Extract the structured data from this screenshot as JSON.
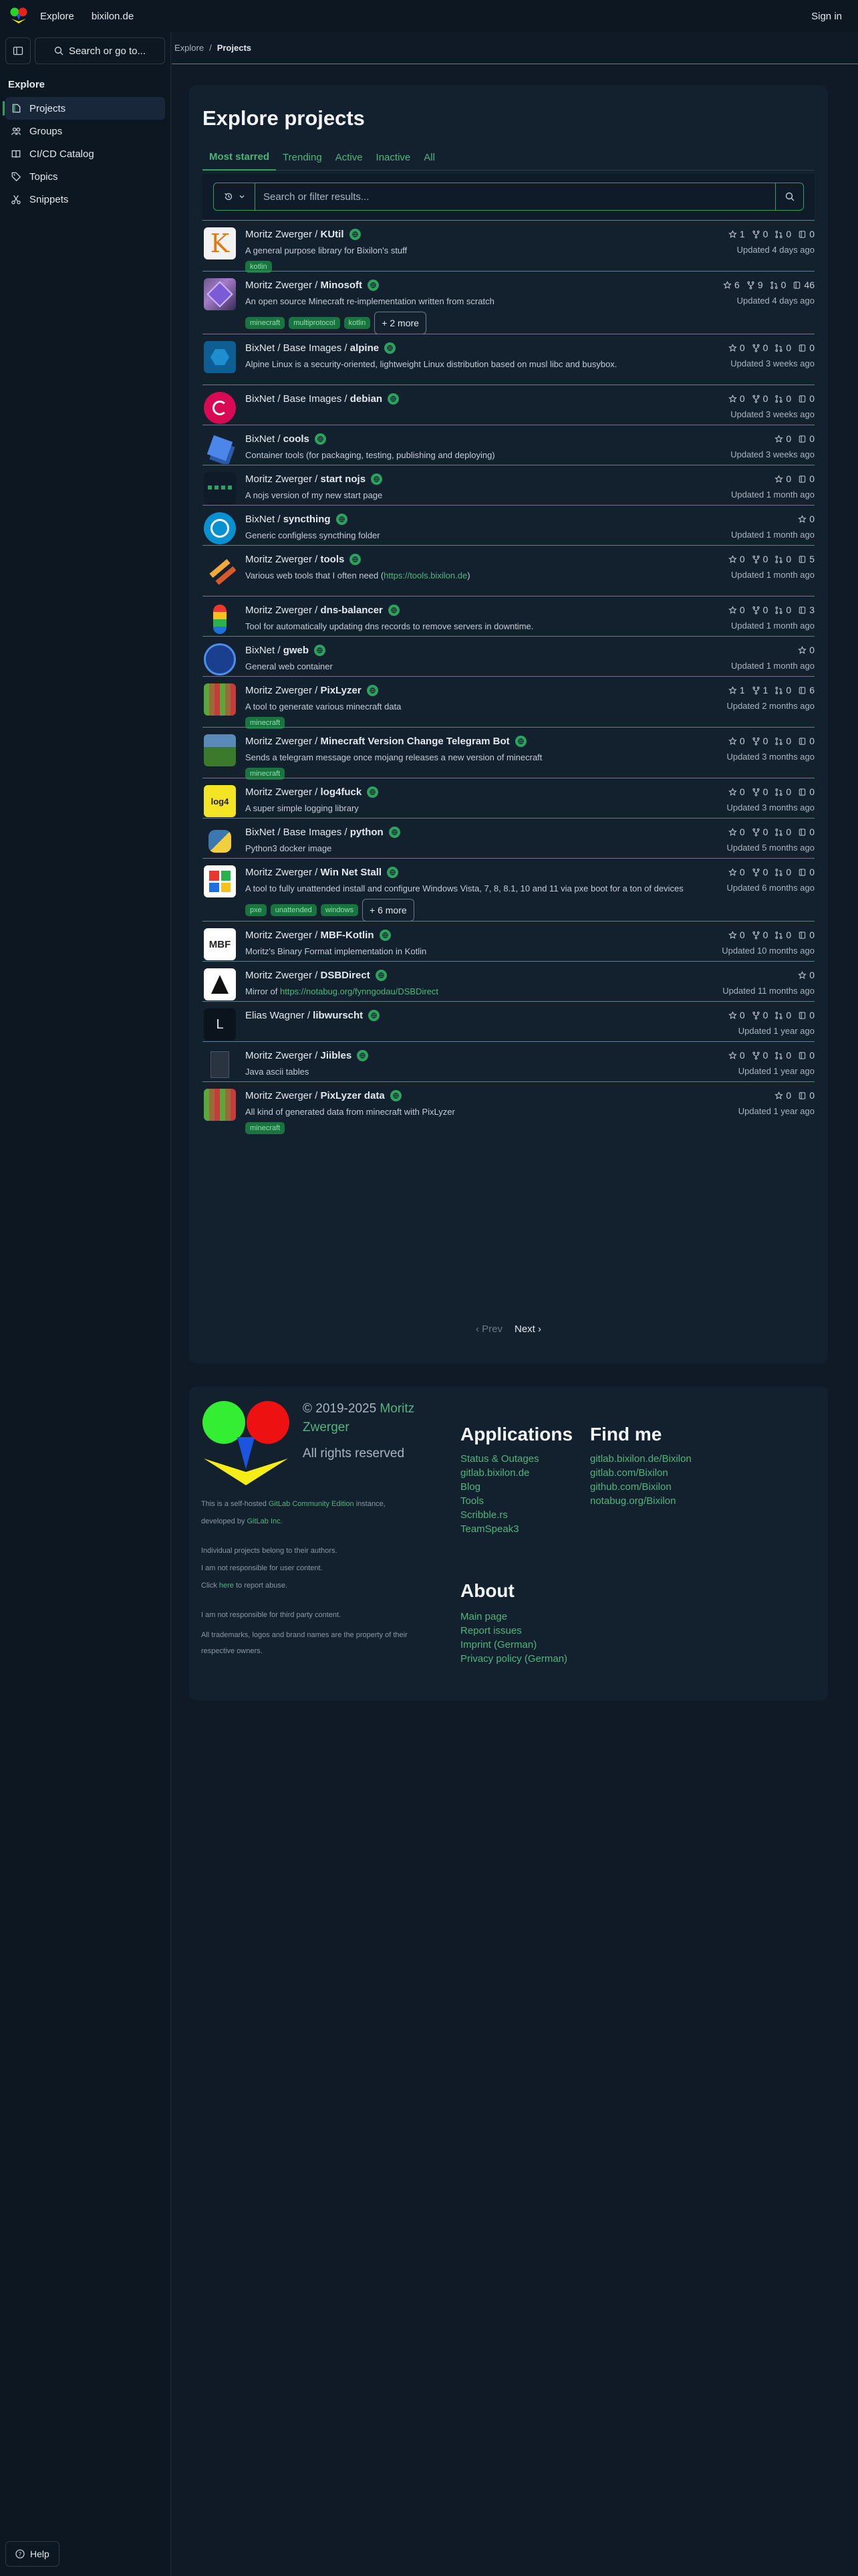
{
  "topbar": {
    "explore": "Explore",
    "site": "bixilon.de",
    "signin": "Sign in"
  },
  "sidebar": {
    "search": "Search or go to...",
    "section": "Explore",
    "items": [
      {
        "label": "Projects",
        "icon": "project-icon"
      },
      {
        "label": "Groups",
        "icon": "groups-icon"
      },
      {
        "label": "CI/CD Catalog",
        "icon": "catalog-icon"
      },
      {
        "label": "Topics",
        "icon": "tag-icon"
      },
      {
        "label": "Snippets",
        "icon": "snippet-icon"
      }
    ],
    "help": "Help"
  },
  "breadcrumb": {
    "root": "Explore",
    "sep": "/",
    "current": "Projects"
  },
  "main": {
    "title": "Explore projects",
    "tabs": [
      "Most starred",
      "Trending",
      "Active",
      "Inactive",
      "All"
    ],
    "search_placeholder": "Search or filter results...",
    "projects": [
      {
        "ns": "Moritz Zwerger / ",
        "name": "KUtil",
        "desc": "A general purpose library for Bixilon's stuff",
        "topics": [
          "kotlin"
        ],
        "more": "",
        "stats": [
          "1",
          "0",
          "0",
          "0"
        ],
        "updated": "Updated 4 days ago"
      },
      {
        "ns": "Moritz Zwerger / ",
        "name": "Minosoft",
        "desc": "An open source Minecraft re-implementation written from scratch",
        "topics": [
          "minecraft",
          "multiprotocol",
          "kotlin"
        ],
        "more": "+ 2 more",
        "stats": [
          "6",
          "9",
          "0",
          "46"
        ],
        "updated": "Updated 4 days ago"
      },
      {
        "ns": "BixNet / Base Images / ",
        "name": "alpine",
        "desc": "Alpine Linux is a security-oriented, lightweight Linux distribution based on musl libc and busybox.",
        "topics": [],
        "more": "",
        "stats": [
          "0",
          "0",
          "0",
          "0"
        ],
        "updated": "Updated 3 weeks ago"
      },
      {
        "ns": "BixNet / Base Images / ",
        "name": "debian",
        "desc": "",
        "topics": [],
        "more": "",
        "stats": [
          "0",
          "0",
          "0",
          "0"
        ],
        "updated": "Updated 3 weeks ago"
      },
      {
        "ns": "BixNet / ",
        "name": "cools",
        "desc": "Container tools (for packaging, testing, publishing and deploying)",
        "topics": [],
        "more": "",
        "stats": [
          "0",
          "0"
        ],
        "updated": "Updated 3 weeks ago"
      },
      {
        "ns": "Moritz Zwerger / ",
        "name": "start nojs",
        "desc": "A nojs version of my new start page",
        "topics": [],
        "more": "",
        "stats": [
          "0",
          "0"
        ],
        "updated": "Updated 1 month ago"
      },
      {
        "ns": "BixNet / ",
        "name": "syncthing",
        "desc": "Generic configless syncthing folder",
        "topics": [],
        "more": "",
        "stats": [
          "0"
        ],
        "updated": "Updated 1 month ago"
      },
      {
        "ns": "Moritz Zwerger / ",
        "name": "tools",
        "desc": "Various web tools that I often need (",
        "link": "https://tools.bixilon.de",
        "desc_end": ")",
        "topics": [],
        "more": "",
        "stats": [
          "0",
          "0",
          "0",
          "5"
        ],
        "updated": "Updated 1 month ago"
      },
      {
        "ns": "Moritz Zwerger / ",
        "name": "dns-balancer",
        "desc": "Tool for automatically updating dns records to remove servers in downtime.",
        "topics": [],
        "more": "",
        "stats": [
          "0",
          "0",
          "0",
          "3"
        ],
        "updated": "Updated 1 month ago"
      },
      {
        "ns": "BixNet / ",
        "name": "gweb",
        "desc": "General web container",
        "topics": [],
        "more": "",
        "stats": [
          "0"
        ],
        "updated": "Updated 1 month ago"
      },
      {
        "ns": "Moritz Zwerger / ",
        "name": "PixLyzer",
        "desc": "A tool to generate various minecraft data",
        "topics": [
          "minecraft"
        ],
        "more": "",
        "stats": [
          "1",
          "1",
          "0",
          "6"
        ],
        "updated": "Updated 2 months ago"
      },
      {
        "ns": "Moritz Zwerger / ",
        "name": "Minecraft Version Change Telegram Bot",
        "desc": "Sends a telegram message once mojang releases a new version of minecraft",
        "topics": [
          "minecraft"
        ],
        "more": "",
        "stats": [
          "0",
          "0",
          "0",
          "0"
        ],
        "updated": "Updated 3 months ago"
      },
      {
        "ns": "Moritz Zwerger / ",
        "name": "log4fuck",
        "desc": "A super simple logging library",
        "topics": [],
        "more": "",
        "stats": [
          "0",
          "0",
          "0",
          "0"
        ],
        "updated": "Updated 3 months ago"
      },
      {
        "ns": "BixNet / Base Images / ",
        "name": "python",
        "desc": "Python3 docker image",
        "topics": [],
        "more": "",
        "stats": [
          "0",
          "0",
          "0",
          "0"
        ],
        "updated": "Updated 5 months ago"
      },
      {
        "ns": "Moritz Zwerger / ",
        "name": "Win Net Stall",
        "desc": "A tool to fully unattended install and configure Windows Vista, 7, 8, 8.1, 10 and 11 via pxe boot for a ton of devices",
        "topics": [
          "pxe",
          "unattended",
          "windows"
        ],
        "more": "+ 6 more",
        "stats": [
          "0",
          "0",
          "0",
          "0"
        ],
        "updated": "Updated 6 months ago"
      },
      {
        "ns": "Moritz Zwerger / ",
        "name": "MBF-Kotlin",
        "desc": "Moritz's Binary Format implementation in Kotlin",
        "topics": [],
        "more": "",
        "stats": [
          "0",
          "0",
          "0",
          "0"
        ],
        "updated": "Updated 10 months ago"
      },
      {
        "ns": "Moritz Zwerger / ",
        "name": "DSBDirect",
        "desc": "Mirror of ",
        "link": "https://notabug.org/fynngodau/DSBDirect",
        "desc_end": "",
        "topics": [],
        "more": "",
        "stats": [
          "0"
        ],
        "updated": "Updated 11 months ago"
      },
      {
        "ns": "Elias Wagner / ",
        "name": "libwurscht",
        "desc": "",
        "topics": [],
        "more": "",
        "stats": [
          "0",
          "0",
          "0",
          "0"
        ],
        "updated": "Updated 1 year ago"
      },
      {
        "ns": "Moritz Zwerger / ",
        "name": "Jiibles",
        "desc": "Java ascii tables",
        "topics": [],
        "more": "",
        "stats": [
          "0",
          "0",
          "0",
          "0"
        ],
        "updated": "Updated 1 year ago"
      },
      {
        "ns": "Moritz Zwerger / ",
        "name": "PixLyzer data",
        "desc": "All kind of generated data from minecraft with PixLyzer",
        "topics": [
          "minecraft"
        ],
        "more": "",
        "stats": [
          "0",
          "0"
        ],
        "updated": "Updated 1 year ago"
      }
    ],
    "pager": {
      "prev": "‹ Prev",
      "next": "Next ›"
    }
  },
  "footer": {
    "copy": "© 2019-2025 ",
    "author": "Moritz Zwerger",
    "rights": "All rights reserved",
    "hosted_a": "This is a self-hosted ",
    "hosted_link": "GitLab Community Edition",
    "hosted_b": " instance,",
    "developed_a": "developed by ",
    "developed_link": "GitLab Inc.",
    "individual": "Individual projects belong to their authors.",
    "not_resp": "I am not responsible for user content.",
    "click_a": "Click ",
    "click_link": "here",
    "click_b": " to report abuse.",
    "third": "I am not responsible for third party content.",
    "trademarks": "All trademarks, logos and brand names are the property of their respective owners.",
    "apps_title": "Applications",
    "apps": [
      "Status & Outages",
      "gitlab.bixilon.de",
      "Blog",
      "Tools",
      "Scribble.rs",
      "TeamSpeak3"
    ],
    "find_title": "Find me",
    "find": [
      "gitlab.bixilon.de/Bixilon",
      "gitlab.com/Bixilon",
      "github.com/Bixilon",
      "notabug.org/Bixilon"
    ],
    "about_title": "About",
    "about": [
      "Main page",
      "Report issues",
      "Imprint (German)",
      "Privacy policy (German)"
    ]
  },
  "colors": {
    "accent": "#2da160",
    "link": "#52b57b",
    "bg": "#0f1a26",
    "panel": "#13202e"
  }
}
